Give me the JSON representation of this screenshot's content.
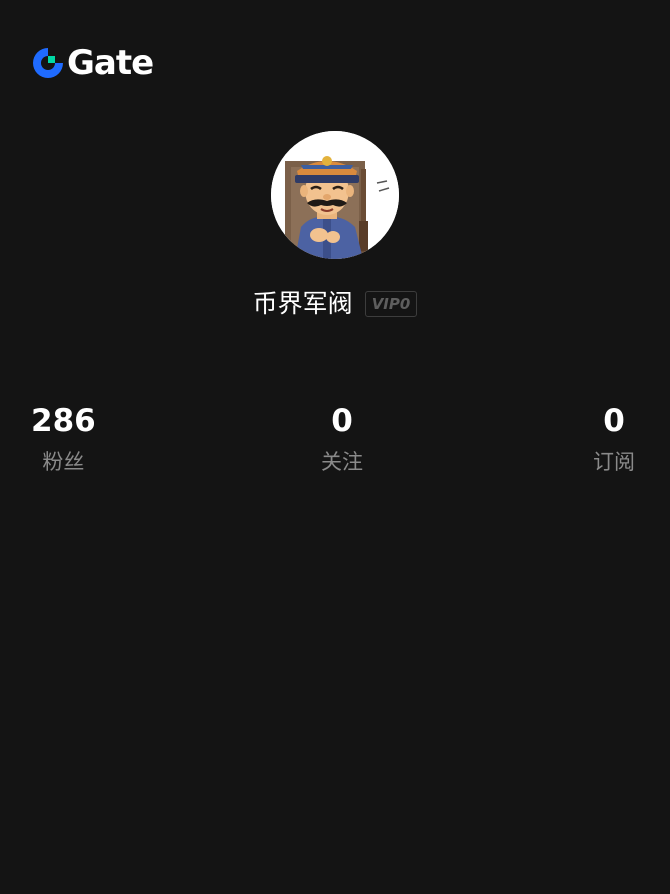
{
  "brand": {
    "name": "Gate",
    "accent_color": "#1f6bff",
    "accent_secondary": "#00d9a6"
  },
  "profile": {
    "username": "币界军阀",
    "vip_label": "VIP0",
    "avatar_icon": "cartoon-officer-avatar"
  },
  "stats": [
    {
      "value": "286",
      "label": "粉丝"
    },
    {
      "value": "0",
      "label": "关注"
    },
    {
      "value": "0",
      "label": "订阅"
    }
  ],
  "colors": {
    "background": "#141414",
    "text_primary": "#ffffff",
    "text_secondary": "#8a8a8a"
  }
}
